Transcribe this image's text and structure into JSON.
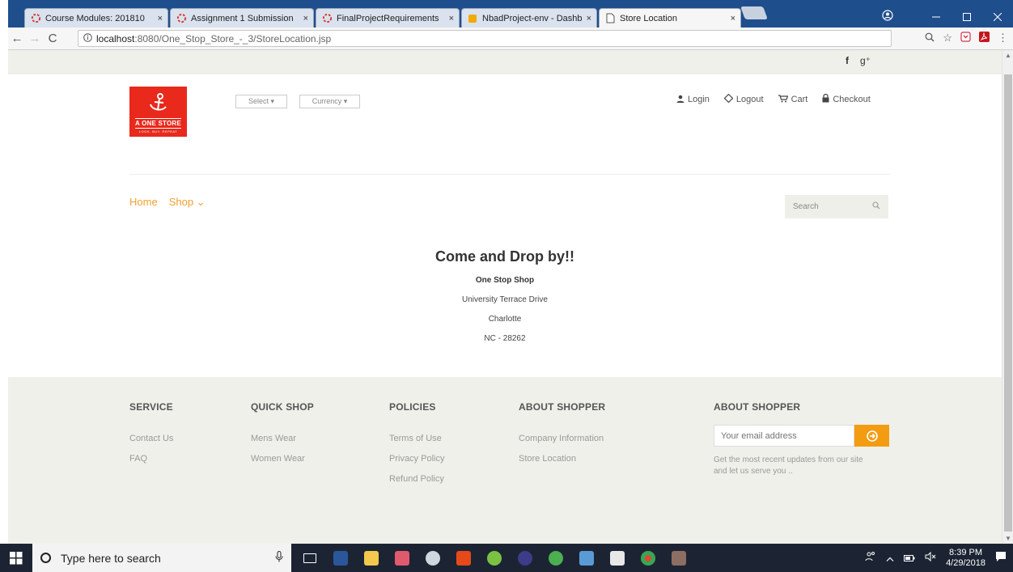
{
  "browser": {
    "tabs": [
      {
        "title": "Course Modules: 201810",
        "icon": "loading-circle-icon",
        "icon_color": "#d93025"
      },
      {
        "title": "Assignment 1 Submission",
        "icon": "loading-circle-icon",
        "icon_color": "#d93025"
      },
      {
        "title": "FinalProjectRequirements",
        "icon": "loading-circle-icon",
        "icon_color": "#d93025"
      },
      {
        "title": "NbadProject-env - Dashb",
        "icon": "aws-cube-icon",
        "icon_color": "#f2a900"
      },
      {
        "title": "Store Location",
        "icon": "document-icon",
        "icon_color": "#555555",
        "active": true
      }
    ],
    "close_glyph": "×",
    "url_host": "localhost",
    "url_path": ":8080/One_Stop_Store_-_3/StoreLocation.jsp"
  },
  "site": {
    "logo": {
      "name": "A ONE STORE",
      "tagline": "LOOK. BUY. REPEAT"
    },
    "select_label": "Select ▾",
    "currency_label": "Currency ▾",
    "user_nav": [
      {
        "label": "Login",
        "icon": "user-icon"
      },
      {
        "label": "Logout",
        "icon": "logout-icon"
      },
      {
        "label": "Cart",
        "icon": "cart-icon"
      },
      {
        "label": "Checkout",
        "icon": "lock-icon"
      }
    ],
    "social": [
      "f",
      "g⁺"
    ],
    "main_nav": {
      "home": "Home",
      "shop": "Shop ⌄"
    },
    "search_placeholder": "Search",
    "accent_color": "#f0a030"
  },
  "content": {
    "heading": "Come and Drop by!!",
    "store_name": "One Stop Shop",
    "address_lines": [
      "University Terrace Drive",
      "Charlotte",
      "NC - 28262"
    ]
  },
  "footer": {
    "service": {
      "title": "SERVICE",
      "links": [
        "Contact Us",
        "FAQ"
      ]
    },
    "quick_shop": {
      "title": "QUICK SHOP",
      "links": [
        "Mens Wear",
        "Women Wear"
      ]
    },
    "policies": {
      "title": "POLICIES",
      "links": [
        "Terms of Use",
        "Privacy Policy",
        "Refund Policy"
      ]
    },
    "about_shopper": {
      "title": "ABOUT SHOPPER",
      "links": [
        "Company Information",
        "Store Location"
      ]
    },
    "newsletter": {
      "title": "ABOUT SHOPPER",
      "email_placeholder": "Your email address",
      "description": "Get the most recent updates from our site and let us serve you .."
    }
  },
  "taskbar": {
    "search_placeholder": "Type here to search",
    "time": "8:39 PM",
    "date": "4/29/2018"
  }
}
